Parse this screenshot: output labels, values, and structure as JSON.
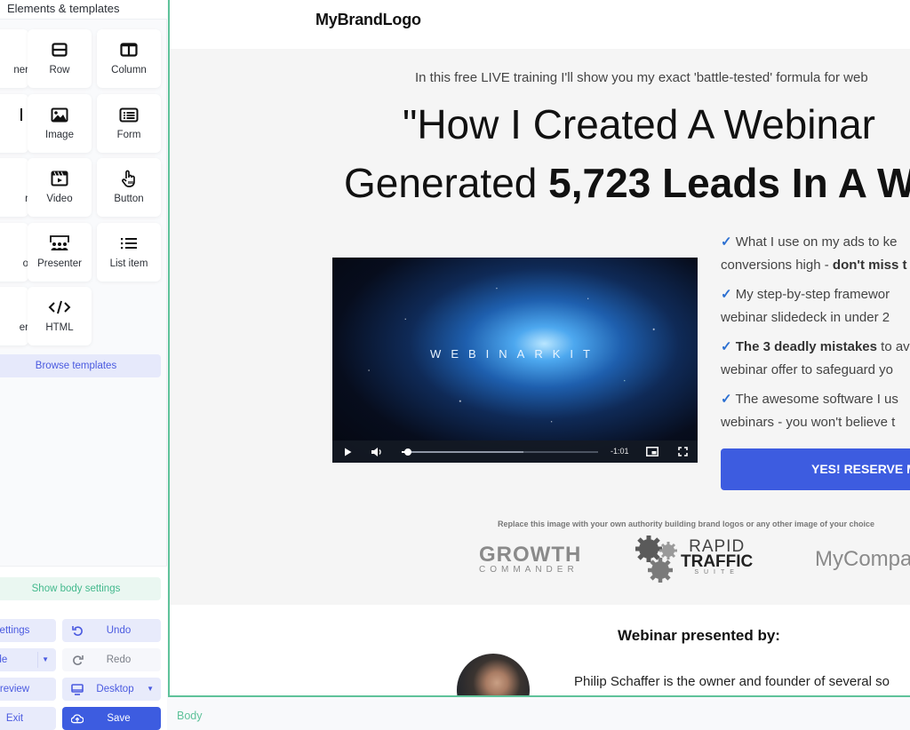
{
  "sidebar": {
    "title": "Elements & templates",
    "tiles": [
      {
        "label": "ner",
        "icon": "container-icon"
      },
      {
        "label": "Row",
        "icon": "row-icon"
      },
      {
        "label": "Column",
        "icon": "column-icon"
      },
      {
        "label": "",
        "icon": "text-icon"
      },
      {
        "label": "Image",
        "icon": "image-icon"
      },
      {
        "label": "Form",
        "icon": "form-icon"
      },
      {
        "label": "r",
        "icon": "timer-icon"
      },
      {
        "label": "Video",
        "icon": "video-icon"
      },
      {
        "label": "Button",
        "icon": "button-pointer-icon"
      },
      {
        "label": "o",
        "icon": "logo-icon"
      },
      {
        "label": "Presenter",
        "icon": "presenter-icon"
      },
      {
        "label": "List item",
        "icon": "list-icon"
      },
      {
        "label": "er",
        "icon": "spacer-icon"
      },
      {
        "label": "HTML",
        "icon": "code-icon"
      }
    ],
    "browse_label": "Browse templates",
    "body_settings_label": "Show body settings",
    "actions": {
      "settings": "ettings",
      "undo": "Undo",
      "hide": "Hide",
      "redo": "Redo",
      "preview": "review",
      "device": "Desktop",
      "exit": "Exit",
      "save": "Save"
    }
  },
  "page": {
    "brand": "MyBrandLogo",
    "pre_headline": "In this free LIVE training I'll show you my exact 'battle-tested' formula for web",
    "headline_line1": "\"How I Created A Webinar",
    "headline_line2_normal": "Generated ",
    "headline_line2_bold": "5,723 Leads In A W",
    "video": {
      "title": "WEBINARKIT",
      "time_remaining": "-1:01",
      "played_fraction": 0.03,
      "buffered_fraction": 0.62
    },
    "bullets": [
      {
        "check": "✓",
        "pre": " What I use on my ads to ke",
        "line2_pre": "conversions high - ",
        "line2_bold": "don't miss t",
        "line2_post": ""
      },
      {
        "check": "✓",
        "pre": " My step-by-step framewor",
        "line2_pre": "webinar slidedeck in under 2",
        "line2_bold": "",
        "line2_post": ""
      },
      {
        "check": "✓",
        "bold": " The 3 deadly mistakes",
        "pre": " to av",
        "line2_pre": "webinar offer to safeguard yo",
        "line2_bold": "",
        "line2_post": ""
      },
      {
        "check": "✓",
        "pre": " The awesome software I us",
        "line2_pre": "webinars - you won't believe t",
        "line2_bold": "",
        "line2_post": ""
      }
    ],
    "cta_label": "YES! RESERVE M",
    "logos_caption": "Replace this image with your own authority building brand logos or any other image of your choice",
    "logos": {
      "growth_line1": "GROWTH",
      "growth_line2": "COMMANDER",
      "rapid_line1": "RAPID",
      "rapid_line2": "TRAFFIC",
      "rapid_line3": "SUITE",
      "mycompany": "MyCompa"
    },
    "presenter": {
      "title": "Webinar presented by:",
      "bio": "Philip Schaffer is the owner and founder of several so"
    }
  },
  "footer": {
    "breadcrumb": "Body"
  },
  "colors": {
    "accent": "#3d5ce0",
    "editor_green": "#5fc29a",
    "check_blue": "#2b6fd1"
  }
}
